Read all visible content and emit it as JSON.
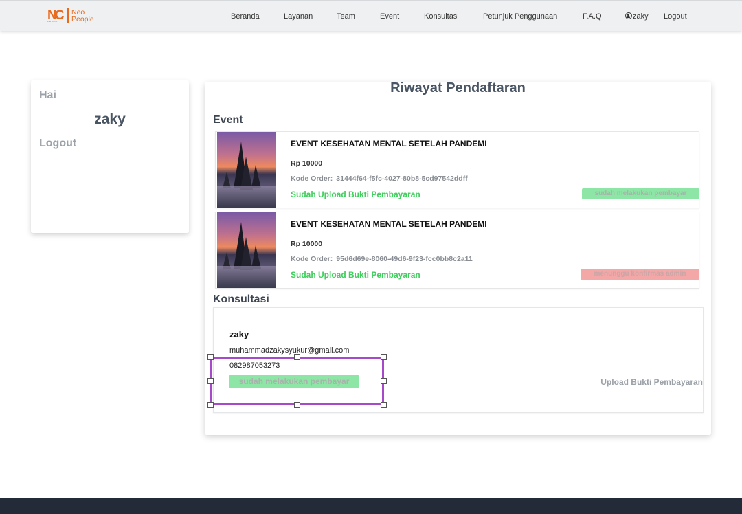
{
  "brand": {
    "mark": "NC",
    "mark_sub": "PEMULI",
    "name_line1": "Neo",
    "name_line2": "People"
  },
  "nav": {
    "items": [
      "Beranda",
      "Layanan",
      "Team",
      "Event",
      "Konsultasi",
      "Petunjuk Penggunaan",
      "F.A.Q"
    ],
    "user": "zaky",
    "logout": "Logout"
  },
  "sidebar": {
    "greeting": "Hai",
    "name": "zaky",
    "logout": "Logout"
  },
  "main": {
    "title": "Riwayat Pendaftaran",
    "event_heading": "Event",
    "events": [
      {
        "title": "EVENT KESEHATAN MENTAL SETELAH PANDEMI",
        "price": "Rp 10000",
        "code_label": "Kode Order:",
        "code": "31444f64-f5fc-4027-80b8-5cd97542ddff",
        "upload_label": "Sudah Upload Bukti Pembayaran",
        "status": "sudah melakukan pembayar",
        "status_color": "#8ee6a6"
      },
      {
        "title": "EVENT KESEHATAN MENTAL SETELAH PANDEMI",
        "price": "Rp 10000",
        "code_label": "Kode Order:",
        "code": "95d6d69e-8060-49d6-9f23-fcc0bb8c2a11",
        "upload_label": "Sudah Upload Bukti Pembayaran",
        "status": "menunggu konfirmas admin",
        "status_color": "#f4a7a7"
      }
    ],
    "konsultasi_heading": "Konsultasi",
    "konsultasi": {
      "name": "zaky",
      "email": "muhammadzakysyukur@gmail.com",
      "phone": "082987053273",
      "status": "sudah melakukan pembayar",
      "upload_label": "Upload Bukti Pembayaran"
    }
  },
  "colors": {
    "accent": "#e86a1e",
    "success": "#3ecf5c",
    "selection": "#a64ac9",
    "footer": "#232b38"
  }
}
